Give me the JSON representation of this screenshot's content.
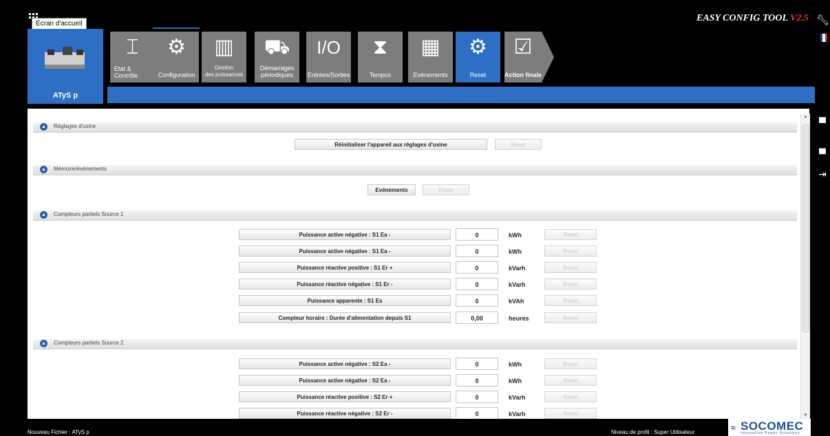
{
  "window": {
    "home_tooltip": "Écran d'accueil",
    "brand": "EASY CONFIG TOOL ",
    "version": "V2.5",
    "device": "ATyS p"
  },
  "tabs": [
    {
      "icon": "state-icon",
      "glyph": "⌶",
      "label": "Etat &\nContrôle"
    },
    {
      "icon": "gears-icon",
      "glyph": "⚙",
      "label": "Configuration"
    },
    {
      "icon": "bar-chart-icon",
      "glyph": "▥",
      "label": "Gestion\ndes puissances"
    },
    {
      "icon": "generator-icon",
      "glyph": "⛟",
      "label": "Démarrages\npériodiques"
    },
    {
      "icon": "io-icon",
      "glyph": "I/O",
      "label": "Entrées/Sorties"
    },
    {
      "icon": "hourglass-icon",
      "glyph": "⧗",
      "label": "Tempos"
    },
    {
      "icon": "events-icon",
      "glyph": "▦",
      "label": "Evénements"
    },
    {
      "icon": "gears-icon",
      "glyph": "⚙",
      "label": "Reset"
    },
    {
      "icon": "check-icon",
      "glyph": "☑",
      "label": "Action finale"
    }
  ],
  "sections": {
    "factory": {
      "title": "Réglages d'usine",
      "button": "Réinitialiser l'appareil aux réglages d'usine",
      "reset": "Reset"
    },
    "memory": {
      "title": "Mémoire/événements",
      "button": "Evénements",
      "reset": "Reset"
    },
    "source1": {
      "title": "Compteurs partiels Source 1",
      "rows": [
        {
          "label": "Puissance active négative : S1 Ea -",
          "value": "0",
          "unit": "kWh",
          "reset": "Reset"
        },
        {
          "label": "Puissance active négative : S1 Ea -",
          "value": "0",
          "unit": "kWh",
          "reset": "Reset"
        },
        {
          "label": "Puissance réactive positive : S1 Er +",
          "value": "0",
          "unit": "kVarh",
          "reset": "Reset"
        },
        {
          "label": "Puissance réactive négative : S1 Er -",
          "value": "0",
          "unit": "kVarh",
          "reset": "Reset"
        },
        {
          "label": "Puissance apparente : S1 Es",
          "value": "0",
          "unit": "kVAh",
          "reset": "Reset"
        },
        {
          "label": "Compteur horaire : Durée d'alimentation depuis S1",
          "value": "0,00",
          "unit": "heures",
          "reset": "Reset"
        }
      ]
    },
    "source2": {
      "title": "Compteurs partiels Source 2",
      "rows": [
        {
          "label": "Puissance active négative : S2 Ea -",
          "value": "0",
          "unit": "kWh",
          "reset": "Reset"
        },
        {
          "label": "Puissance active négative : S2 Ea -",
          "value": "0",
          "unit": "kWh",
          "reset": "Reset"
        },
        {
          "label": "Puissance réactive positive : S2 Er +",
          "value": "0",
          "unit": "kVarh",
          "reset": "Reset"
        },
        {
          "label": "Puissance réactive négative : S2 Er -",
          "value": "0",
          "unit": "kVarh",
          "reset": "Reset"
        }
      ]
    }
  },
  "right_tools": [
    {
      "icon": "save-icon",
      "glyph": "▀"
    },
    {
      "icon": "save-as-icon",
      "glyph": "▄"
    },
    {
      "icon": "exit-icon",
      "glyph": "⇥"
    }
  ],
  "status": {
    "file": "Nouveau Fichier : ATyS p",
    "profile": "Niveau de profil : Super Utilisateur"
  },
  "logo": {
    "name": "SOCOMEC",
    "tagline": "Innovative Power Solutions"
  },
  "colors": {
    "accent": "#2e6ec4",
    "tab_gray": "#7d7d7d",
    "disabled_text": "#c8c8c8"
  }
}
